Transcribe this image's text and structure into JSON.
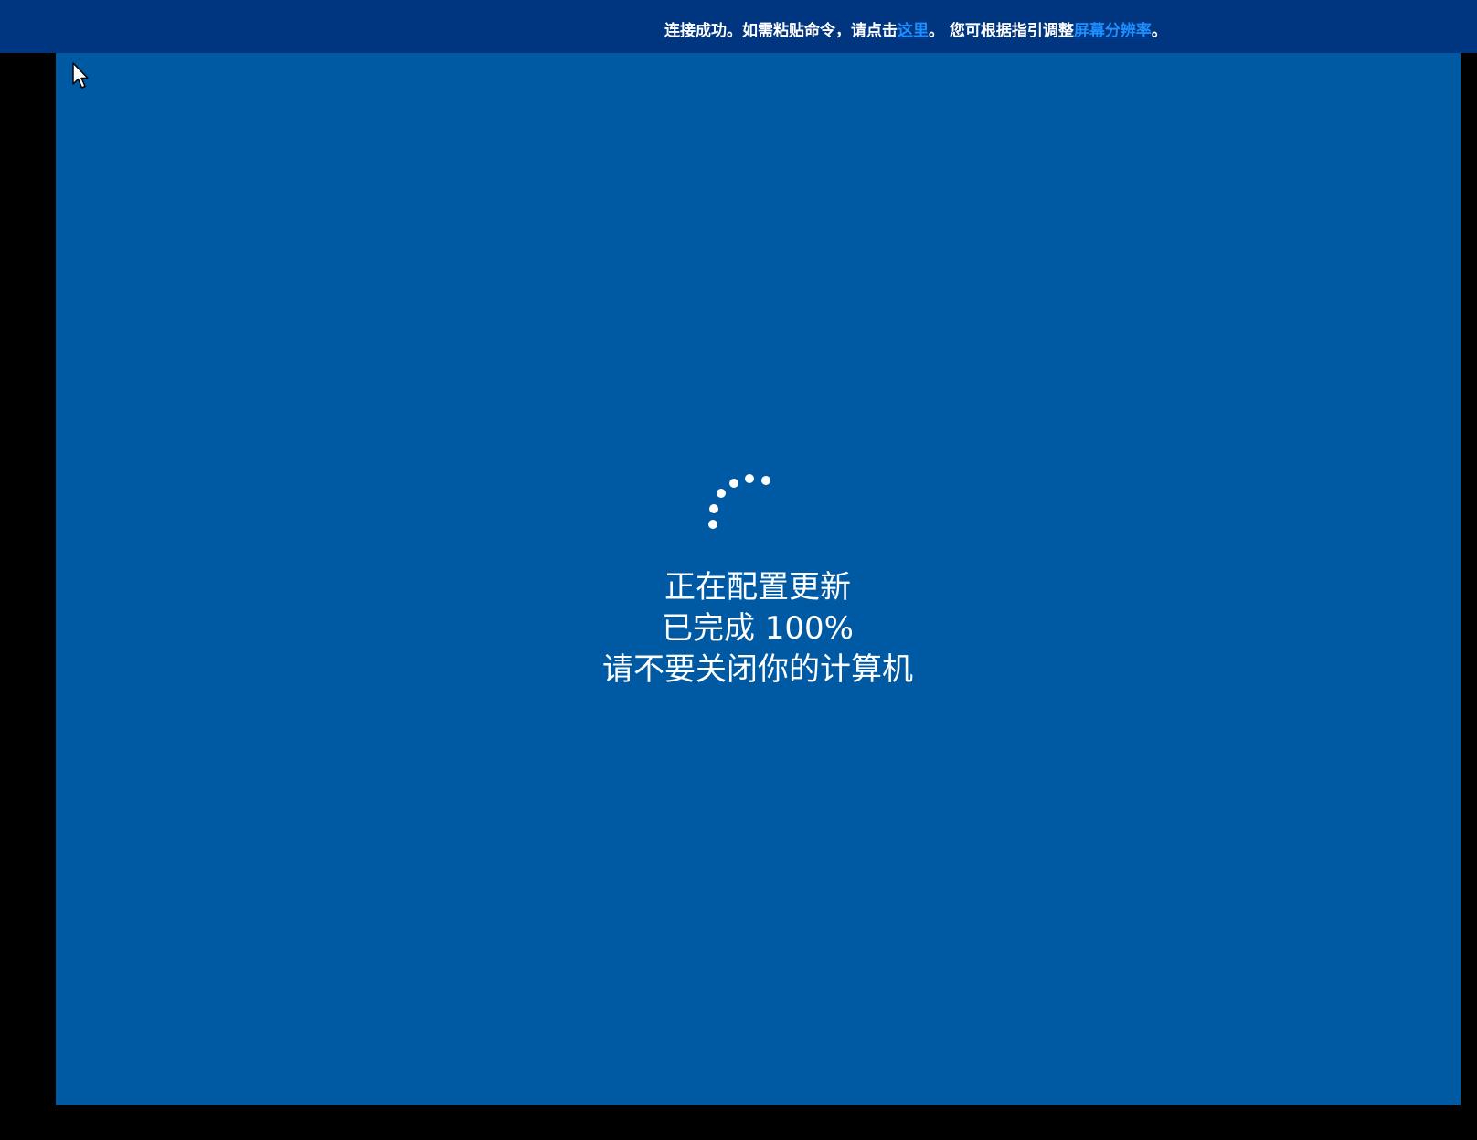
{
  "topbar": {
    "prefix": "连接成功。如需粘贴命令，请点击",
    "paste_link": "这里",
    "middle": "。 您可根据指引调整",
    "resolution_link": "屏幕分辨率",
    "suffix": "。"
  },
  "update_screen": {
    "line1": "正在配置更新",
    "line2": "已完成 100%",
    "line3": "请不要关闭你的计算机",
    "progress_percent": 100
  },
  "icons": {
    "cursor": "mouse-pointer-icon",
    "spinner": "loading-spinner-icon"
  },
  "colors": {
    "topbar_bg": "#003580",
    "screen_bg": "#005aa3",
    "link": "#1e8fff",
    "letterbox": "#000000"
  }
}
